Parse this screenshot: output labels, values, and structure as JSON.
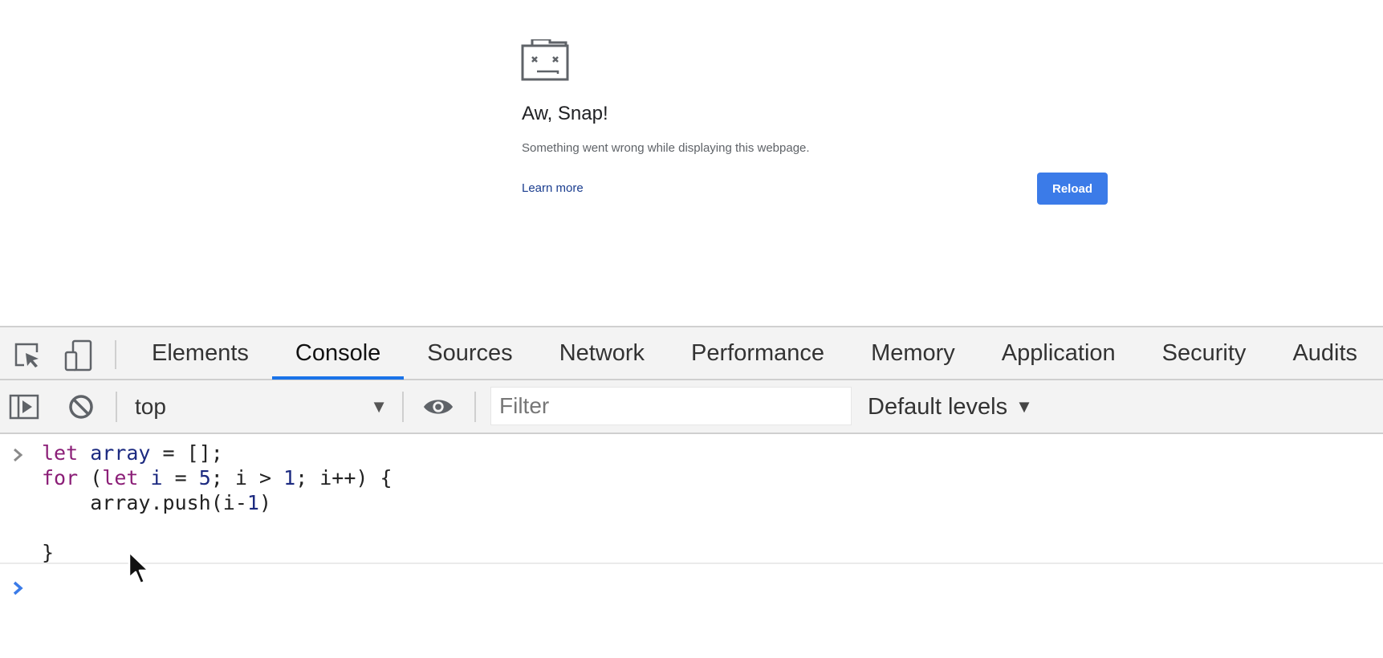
{
  "snap_page": {
    "title": "Aw, Snap!",
    "description": "Something went wrong while displaying this webpage.",
    "learn_more": "Learn more",
    "reload_label": "Reload",
    "accent_color": "#3b7be8"
  },
  "devtools": {
    "tabs": [
      {
        "label": "Elements",
        "active": false
      },
      {
        "label": "Console",
        "active": true
      },
      {
        "label": "Sources",
        "active": false
      },
      {
        "label": "Network",
        "active": false
      },
      {
        "label": "Performance",
        "active": false
      },
      {
        "label": "Memory",
        "active": false
      },
      {
        "label": "Application",
        "active": false
      },
      {
        "label": "Security",
        "active": false
      },
      {
        "label": "Audits",
        "active": false
      }
    ],
    "toolbar": {
      "context": "top",
      "filter_placeholder": "Filter",
      "levels_label": "Default levels"
    },
    "console": {
      "entry_code": [
        "let array = [];",
        "for (let i = 5; i > 1; i++) {",
        "    array.push(i-1)",
        "",
        "}"
      ]
    },
    "icons": [
      "inspect-element-icon",
      "device-toolbar-icon",
      "show-sidebar-icon",
      "clear-console-icon",
      "eye-icon",
      "prompt-chevron-icon",
      "mouse-cursor-icon"
    ]
  }
}
